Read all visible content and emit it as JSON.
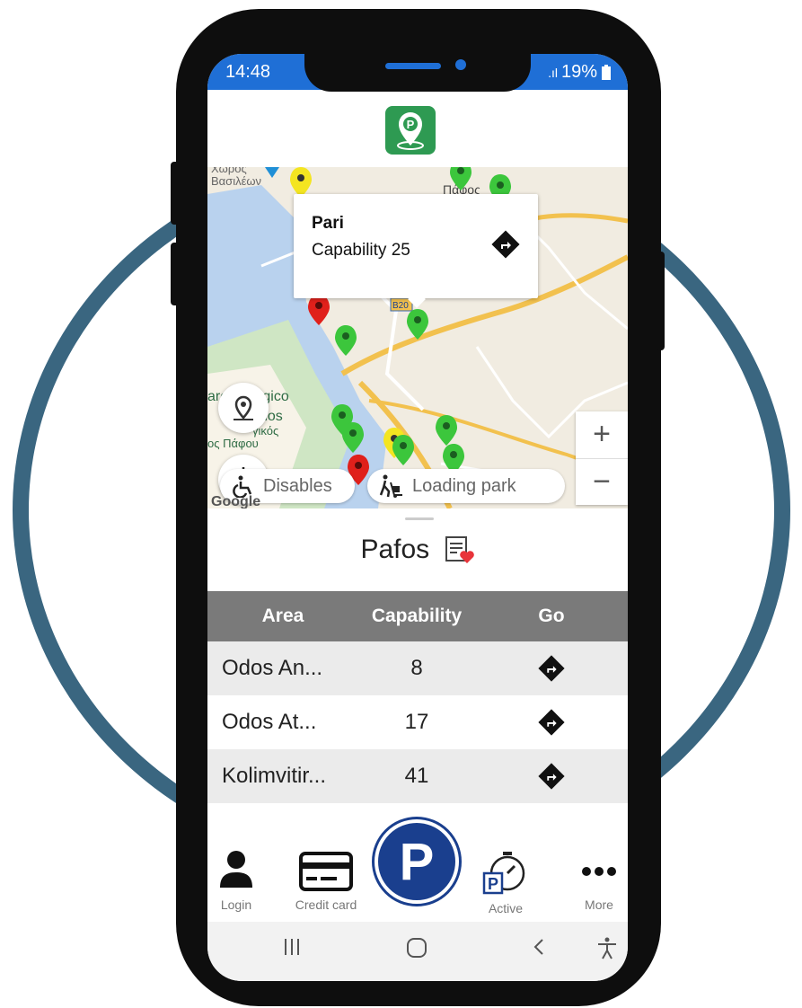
{
  "status_bar": {
    "time": "14:48",
    "signal": ".ıl",
    "battery": "19%"
  },
  "map": {
    "labels": [
      "Χώρος",
      "Βασιλέων",
      "Πάφος",
      "archeologico",
      "hos",
      "γικός",
      "ος Πάφου",
      "Β20"
    ],
    "popup": {
      "name": "Pari",
      "capability": "Capability 25"
    },
    "filters": {
      "disabled_label": "Disables",
      "loading_label": "Loading park"
    },
    "zoom_in": "+",
    "zoom_out": "−",
    "attribution": "Google"
  },
  "city": {
    "title": "Pafos"
  },
  "table": {
    "headers": {
      "area": "Area",
      "capability": "Capability",
      "go": "Go"
    },
    "rows": [
      {
        "area": "Odos An...",
        "capability": "8"
      },
      {
        "area": "Odos At...",
        "capability": "17"
      },
      {
        "area": "Kolimvitir...",
        "capability": "41"
      }
    ]
  },
  "bottom_nav": {
    "login": "Login",
    "credit_card": "Credit card",
    "park": "P",
    "active": "Active",
    "more": "More"
  },
  "colors": {
    "accent": "#1f6fd6",
    "park_button": "#1a3f8e",
    "ring": "#3a6680",
    "logo": "#2e9a52"
  }
}
